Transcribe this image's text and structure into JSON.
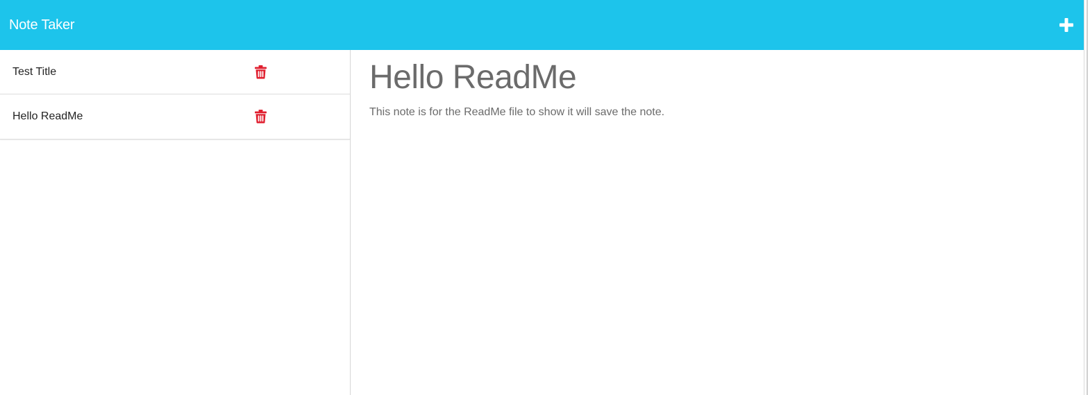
{
  "app": {
    "title": "Note Taker",
    "add_icon": "plus-icon",
    "accent_color": "#1dc4eb",
    "delete_color": "#e01f2f"
  },
  "sidebar": {
    "notes": [
      {
        "title": "Test Title",
        "icon": "trash-icon"
      },
      {
        "title": "Hello ReadMe",
        "icon": "trash-icon"
      }
    ]
  },
  "main": {
    "note_title": "Hello ReadMe",
    "note_text": "This note is for the ReadMe file to show it will save the note."
  }
}
